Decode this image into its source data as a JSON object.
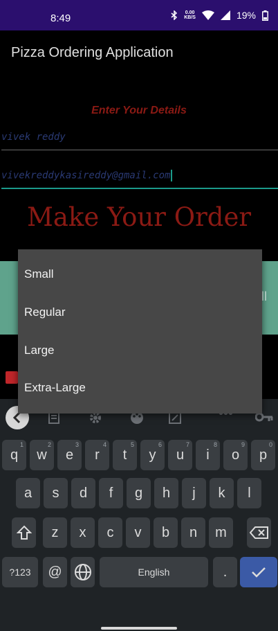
{
  "status_bar": {
    "time": "8:49",
    "net_speed_value": "0.00",
    "net_speed_unit": "KB/S",
    "battery": "19%"
  },
  "app": {
    "title": "Pizza Ordering Application",
    "enter_details": "Enter Your Details",
    "name_value": "vivek reddy",
    "email_value": "vivekreddykasireddy@gmail.com",
    "make_order": "Make Your Order"
  },
  "dropdown": {
    "options": [
      "Small",
      "Regular",
      "Large",
      "Extra-Large"
    ]
  },
  "keyboard": {
    "row1": [
      {
        "key": "q",
        "hint": "1"
      },
      {
        "key": "w",
        "hint": "2"
      },
      {
        "key": "e",
        "hint": "3"
      },
      {
        "key": "r",
        "hint": "4"
      },
      {
        "key": "t",
        "hint": "5"
      },
      {
        "key": "y",
        "hint": "6"
      },
      {
        "key": "u",
        "hint": "7"
      },
      {
        "key": "i",
        "hint": "8"
      },
      {
        "key": "o",
        "hint": "9"
      },
      {
        "key": "p",
        "hint": "0"
      }
    ],
    "row2": [
      "a",
      "s",
      "d",
      "f",
      "g",
      "h",
      "j",
      "k",
      "l"
    ],
    "row3": [
      "z",
      "x",
      "c",
      "v",
      "b",
      "n",
      "m"
    ],
    "symbols_label": "?123",
    "at_label": "@",
    "space_label": "English",
    "period_label": "."
  },
  "colors": {
    "status_bar": "#2b0f6e",
    "accent_red": "#8b1a14",
    "teal": "#1b9a8a",
    "enter_key": "#3b5aa6"
  }
}
